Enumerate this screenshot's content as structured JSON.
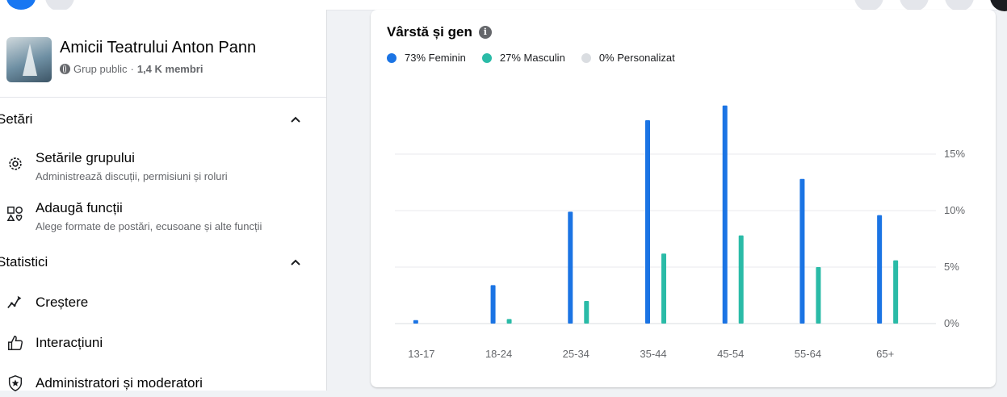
{
  "group": {
    "name": "Amicii Teatrului Anton Pann",
    "privacy": "Grup public",
    "separator": " · ",
    "members": "1,4 K membri"
  },
  "sidebar": {
    "settings_section": "Setări",
    "settings_items": [
      {
        "title": "Setările grupului",
        "subtitle": "Administrează discuții, permisiuni și roluri",
        "icon": "gear-icon"
      },
      {
        "title": "Adaugă funcții",
        "subtitle": "Alege formate de postări, ecusoane și alte funcții",
        "icon": "shapes-icon"
      }
    ],
    "stats_section": "Statistici",
    "stats_items": [
      {
        "title": "Creștere",
        "icon": "growth-icon"
      },
      {
        "title": "Interacțiuni",
        "icon": "thumbs-up-icon"
      },
      {
        "title": "Administratori și moderatori",
        "icon": "admin-star-icon"
      }
    ]
  },
  "card": {
    "title": "Vârstă și gen",
    "legend": [
      {
        "label": "73% Feminin",
        "color": "#1b74e4"
      },
      {
        "label": "27% Masculin",
        "color": "#2abba7"
      },
      {
        "label": "0% Personalizat",
        "color": "#dadde1"
      }
    ]
  },
  "chart_data": {
    "type": "bar",
    "categories": [
      "13-17",
      "18-24",
      "25-34",
      "35-44",
      "45-54",
      "55-64",
      "65+"
    ],
    "series": [
      {
        "name": "Feminin",
        "color": "#1b74e4",
        "values": [
          0.3,
          3.4,
          9.9,
          18.0,
          19.3,
          12.8,
          9.6
        ]
      },
      {
        "name": "Masculin",
        "color": "#2abba7",
        "values": [
          0,
          0.4,
          2.0,
          6.2,
          7.8,
          5.0,
          5.6
        ]
      }
    ],
    "yticks": [
      0,
      5,
      10,
      15
    ],
    "ytick_labels": [
      "0%",
      "5%",
      "10%",
      "15%"
    ],
    "ylim": [
      0,
      20
    ],
    "grid": true,
    "y_axis_side": "right"
  }
}
